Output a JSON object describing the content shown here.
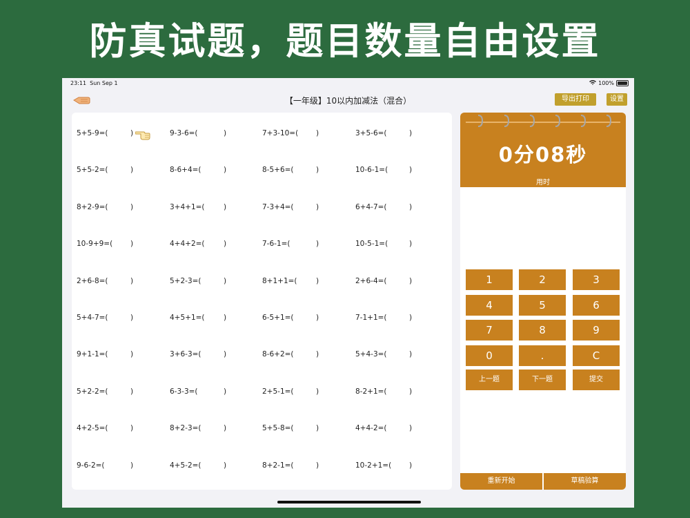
{
  "banner": {
    "title": "防真试题，题目数量自由设置"
  },
  "status_bar": {
    "time": "23:11",
    "date": "Sun Sep 1",
    "battery": "100%"
  },
  "nav": {
    "title": "【一年级】10以内加减法（混合）",
    "export_label": "导出打印",
    "settings_label": "设置"
  },
  "questions": [
    [
      "5+5-9=(",
      "9-3-6=(",
      "7+3-10=(",
      "3+5-6=("
    ],
    [
      "5+5-2=(",
      "8-6+4=(",
      "8-5+6=(",
      "10-6-1=("
    ],
    [
      "8+2-9=(",
      "3+4+1=(",
      "7-3+4=(",
      "6+4-7=("
    ],
    [
      "10-9+9=(",
      "4+4+2=(",
      "7-6-1=(",
      "10-5-1=("
    ],
    [
      "2+6-8=(",
      "5+2-3=(",
      "8+1+1=(",
      "2+6-4=("
    ],
    [
      "5+4-7=(",
      "4+5+1=(",
      "6-5+1=(",
      "7-1+1=("
    ],
    [
      "9+1-1=(",
      "3+6-3=(",
      "8-6+2=(",
      "5+4-3=("
    ],
    [
      "5+2-2=(",
      "6-3-3=(",
      "2+5-1=(",
      "8-2+1=("
    ],
    [
      "4+2-5=(",
      "8+2-3=(",
      "5+5-8=(",
      "4+4-2=("
    ],
    [
      "9-6-2=(",
      "4+5-2=(",
      "8+2-1=(",
      "10-2+1=("
    ]
  ],
  "paren_close": ")",
  "timer": {
    "display": "0分08秒",
    "label": "用时"
  },
  "keypad": {
    "keys": [
      "1",
      "2",
      "3",
      "4",
      "5",
      "6",
      "7",
      "8",
      "9",
      "0",
      ".",
      "C"
    ],
    "prev_label": "上一题",
    "next_label": "下一题",
    "submit_label": "提交"
  },
  "bottom": {
    "restart_label": "重新开始",
    "draft_label": "草稿验算"
  },
  "colors": {
    "background": "#2c6b3e",
    "accent": "#c8811f",
    "gold_button": "#c1a02d"
  }
}
